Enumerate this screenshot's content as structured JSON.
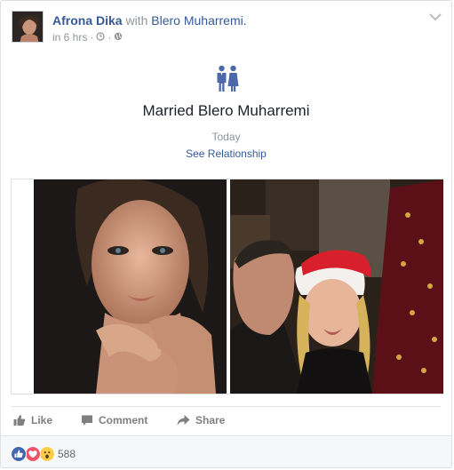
{
  "post": {
    "author": "Afrona Dika",
    "with_text": "with",
    "tagged": "Blero Muharremi.",
    "time": "in 6 hrs",
    "separator": "·",
    "clock_icon": "clock-icon",
    "audience_icon": "globe-icon"
  },
  "life_event": {
    "icon": "married-couple-icon",
    "title": "Married Blero Muharremi",
    "date": "Today",
    "link": "See Relationship"
  },
  "photos": [
    {
      "name": "portrait-photo"
    },
    {
      "name": "family-christmas-photo"
    }
  ],
  "actions": {
    "like": "Like",
    "comment": "Comment",
    "share": "Share"
  },
  "reactions": {
    "types": [
      "like",
      "love",
      "wow"
    ],
    "count": "588"
  },
  "colors": {
    "link": "#365899",
    "secondary_text": "#90949c",
    "like_blue": "#4267b2",
    "love_red": "#f25268",
    "wow_yellow": "#fbcd48"
  }
}
